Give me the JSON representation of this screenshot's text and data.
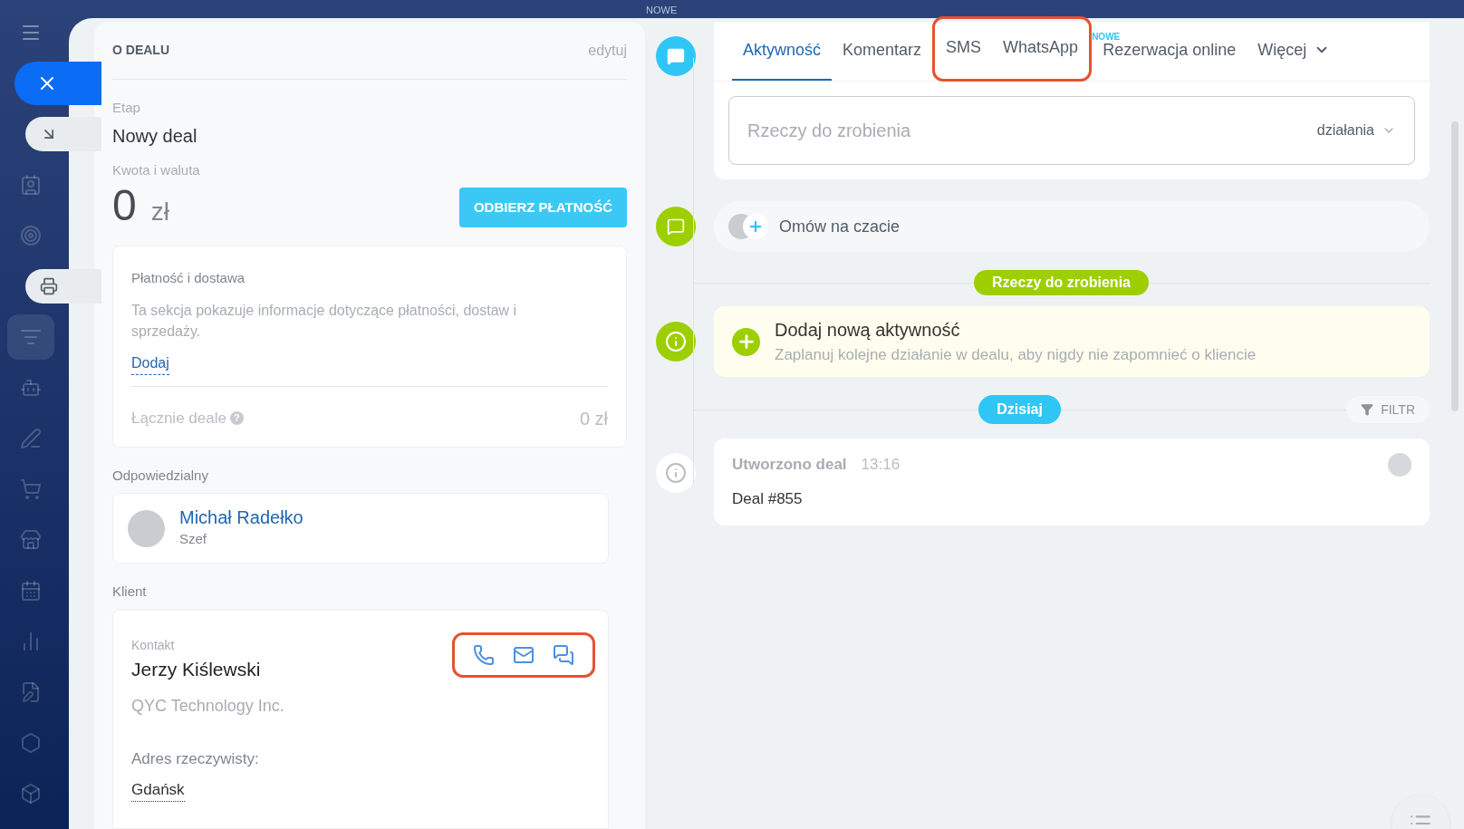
{
  "top_strip": {
    "badge": "NOWE"
  },
  "sidebar": {
    "items": [
      {
        "kind": "menu"
      },
      {
        "kind": "close"
      },
      {
        "kind": "arrow"
      },
      {
        "kind": "contact"
      },
      {
        "kind": "target"
      },
      {
        "kind": "printer"
      },
      {
        "kind": "funnel",
        "selected": true
      },
      {
        "kind": "robot"
      },
      {
        "kind": "pen"
      },
      {
        "kind": "cart"
      },
      {
        "kind": "store"
      },
      {
        "kind": "calendar"
      },
      {
        "kind": "chart"
      },
      {
        "kind": "document"
      },
      {
        "kind": "hexagon"
      },
      {
        "kind": "box"
      }
    ]
  },
  "deal": {
    "title": "O DEALU",
    "edit": "edytuj",
    "stage_label": "Etap",
    "stage": "Nowy deal",
    "amount_label": "Kwota i waluta",
    "amount": "0",
    "currency": "zł",
    "pay_button": "ODBIERZ PŁATNOŚĆ",
    "payment": {
      "title": "Płatność i dostawa",
      "text": "Ta sekcja pokazuje informacje dotyczące płatności, dostaw i sprzedaży.",
      "add": "Dodaj",
      "total_label": "Łącznie deale",
      "help": "?",
      "total": "0 zł"
    },
    "responsible_label": "Odpowiedzialny",
    "responsible": {
      "name": "Michał Radełko",
      "role": "Szef"
    },
    "client_label": "Klient",
    "client": {
      "kind_label": "Kontakt",
      "name": "Jerzy Kiślewski",
      "company": "QYC Technology Inc.",
      "address_label": "Adres rzeczywisty:",
      "address": "Gdańsk",
      "actions": [
        {
          "kind": "phone"
        },
        {
          "kind": "mail"
        },
        {
          "kind": "chat"
        }
      ],
      "actions_highlighted": true
    }
  },
  "timeline": {
    "tabs": [
      {
        "label": "Aktywność",
        "selected": true,
        "highlighted": false
      },
      {
        "label": "Komentarz",
        "selected": false,
        "highlighted": false
      },
      {
        "label": "SMS",
        "selected": false,
        "highlighted": true
      },
      {
        "label": "WhatsApp",
        "selected": false,
        "highlighted": true
      },
      {
        "label": "Rezerwacja online",
        "selected": false,
        "highlighted": false,
        "badge": "NOWE"
      },
      {
        "label": "Więcej",
        "selected": false,
        "highlighted": false,
        "dropdown": true
      }
    ],
    "todo_placeholder": "Rzeczy do zrobienia",
    "actions_dropdown": "działania",
    "chat": "Omów na czacie",
    "todo_divider": "Rzeczy do zrobienia",
    "new_activity": {
      "title": "Dodaj nową aktywność",
      "text": "Zaplanuj kolejne działanie w dealu, aby nigdy nie zapomnieć o kliencie"
    },
    "today_divider": "Dzisiaj",
    "filter": "FILTR",
    "entries": [
      {
        "title": "Utworzono deal",
        "time": "13:16",
        "text": "Deal #855"
      }
    ]
  }
}
